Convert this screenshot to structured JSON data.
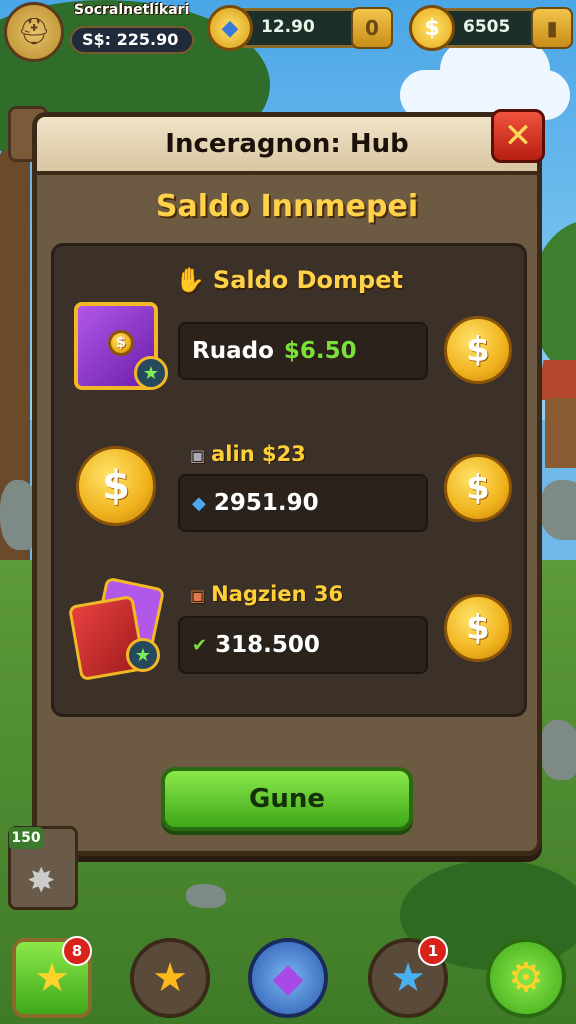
{
  "hud": {
    "player_name": "Socralnetlikari",
    "player_cash": "S$: 225.90",
    "gem_counter": {
      "value": "12.90",
      "plus_label": "0"
    },
    "coin_counter": {
      "value": "6505",
      "coin_symbol": "$"
    }
  },
  "dialog": {
    "title": "Inceragnon: Hub",
    "close_label": "✕",
    "section_heading": "Saldo Innmepei",
    "panel_heading": "Saldo Dompet",
    "rows": [
      {
        "label": "",
        "field_text": "Ruado",
        "field_value": "$6.50",
        "coin_symbol": "$"
      },
      {
        "label": "alin $23",
        "field_text": "2951.90",
        "coin_symbol": "$"
      },
      {
        "label": "Nagzien 36",
        "field_text": "318.500",
        "coin_symbol": "$"
      }
    ],
    "action_button": "Gune"
  },
  "side_widget": {
    "tag": "150"
  },
  "bottom_nav": {
    "items": [
      {
        "icon": "star-icon",
        "badge": "8"
      },
      {
        "icon": "star-icon"
      },
      {
        "icon": "gem-icon"
      },
      {
        "icon": "star-icon",
        "badge": "1"
      },
      {
        "icon": "gear-icon"
      }
    ]
  },
  "colors": {
    "accent_gold": "#ffd24a",
    "button_green": "#3fa81a",
    "close_red": "#b81f12",
    "value_green": "#7be03a"
  }
}
